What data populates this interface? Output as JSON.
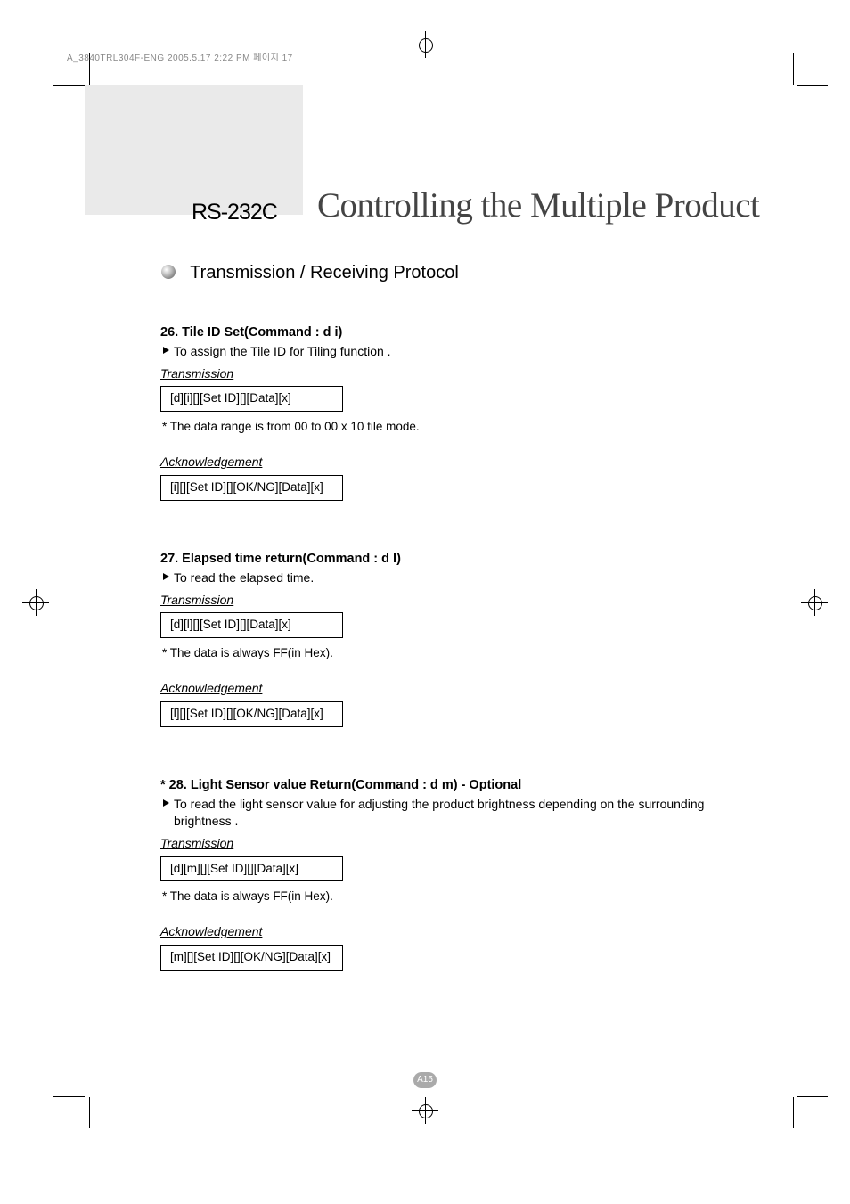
{
  "header_meta": "A_3840TRL304F-ENG  2005.5.17  2:22 PM  페이지 17",
  "title_block": {
    "rs232c": "RS-232C",
    "main_title": "Controlling the Multiple Product"
  },
  "section_header": "Transmission / Receiving Protocol",
  "commands": [
    {
      "title": "26. Tile ID Set(Command : d i)",
      "desc": "To assign the Tile ID for Tiling function .",
      "transmission_label": "Transmission",
      "transmission_box": "[d][i][][Set ID][][Data][x]",
      "transmission_note": "* The data range is from 00 to 00 x 10 tile mode.",
      "ack_label": "Acknowledgement",
      "ack_box": "[i][][Set ID][][OK/NG][Data][x]"
    },
    {
      "title": "27. Elapsed time return(Command : d l)",
      "desc": "To read the elapsed time.",
      "transmission_label": "Transmission",
      "transmission_box": "[d][l][][Set ID][][Data][x]",
      "transmission_note": " * The data is always FF(in Hex).",
      "ack_label": "Acknowledgement",
      "ack_box": "[l][][Set ID][][OK/NG][Data][x]"
    },
    {
      "title": "* 28. Light Sensor value Return(Command : d m) - Optional",
      "desc": "To read the light sensor value for adjusting the product brightness depending on the surrounding brightness .",
      "transmission_label": "Transmission",
      "transmission_box": "[d][m][][Set ID][][Data][x]",
      "transmission_note": " * The data is always FF(in Hex).",
      "ack_label": "Acknowledgement",
      "ack_box": "[m][][Set ID][][OK/NG][Data][x]"
    }
  ],
  "page_number": "A15"
}
